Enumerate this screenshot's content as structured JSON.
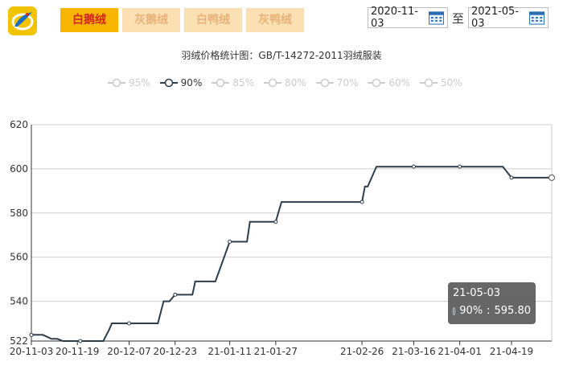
{
  "tabs": [
    {
      "label": "白鹅绒",
      "active": true
    },
    {
      "label": "灰鹅绒",
      "active": false
    },
    {
      "label": "白鸭绒",
      "active": false
    },
    {
      "label": "灰鸭绒",
      "active": false
    }
  ],
  "date_range": {
    "start": "2020-11-03",
    "separator": "至",
    "end": "2021-05-03"
  },
  "tooltip": {
    "date": "21-05-03",
    "series": "90%",
    "sep": " : ",
    "value": "595.80"
  },
  "colors": {
    "line": "#2f3e4d",
    "tab_active_bg": "#f7b500",
    "tab_active_text": "#d0281b",
    "tab_bg": "#fbe0b3",
    "tab_text": "#e8b27a",
    "logo": "#f2c300"
  },
  "chart_data": {
    "type": "line",
    "title": "羽绒价格统计图：GB/T-14272-2011羽绒服装",
    "legend": [
      "95%",
      "90%",
      "85%",
      "80%",
      "70%",
      "60%",
      "50%"
    ],
    "active_series": "90%",
    "x_ticks": [
      "20-11-03",
      "20-11-19",
      "20-12-07",
      "20-12-23",
      "21-01-11",
      "21-01-27",
      "21-02-26",
      "21-03-16",
      "21-04-01",
      "21-04-19"
    ],
    "ylim": [
      522,
      620
    ],
    "y_ticks": [
      522,
      540,
      560,
      580,
      600,
      620
    ],
    "grid": true,
    "series": [
      {
        "name": "90%",
        "points": [
          [
            "2020-11-03",
            524.8
          ],
          [
            "2020-11-07",
            524.8
          ],
          [
            "2020-11-10",
            523
          ],
          [
            "2020-11-12",
            523
          ],
          [
            "2020-11-14",
            522
          ],
          [
            "2020-11-20",
            522
          ],
          [
            "2020-11-28",
            522
          ],
          [
            "2020-11-30",
            527
          ],
          [
            "2020-12-01",
            530
          ],
          [
            "2020-12-07",
            530
          ],
          [
            "2020-12-17",
            530
          ],
          [
            "2020-12-19",
            540
          ],
          [
            "2020-12-21",
            540
          ],
          [
            "2020-12-23",
            543
          ],
          [
            "2020-12-29",
            543
          ],
          [
            "2020-12-30",
            549
          ],
          [
            "2021-01-06",
            549
          ],
          [
            "2021-01-11",
            567
          ],
          [
            "2021-01-17",
            567
          ],
          [
            "2021-01-18",
            576
          ],
          [
            "2021-01-27",
            576
          ],
          [
            "2021-01-29",
            585
          ],
          [
            "2021-02-26",
            585
          ],
          [
            "2021-02-27",
            592
          ],
          [
            "2021-02-28",
            592
          ],
          [
            "2021-03-03",
            601
          ],
          [
            "2021-03-16",
            601
          ],
          [
            "2021-04-01",
            601
          ],
          [
            "2021-04-16",
            601
          ],
          [
            "2021-04-19",
            596
          ],
          [
            "2021-05-03",
            596
          ]
        ],
        "markers": [
          [
            "2020-11-03",
            524.8
          ],
          [
            "2020-11-20",
            522
          ],
          [
            "2020-12-07",
            530
          ],
          [
            "2020-12-23",
            543
          ],
          [
            "2021-01-11",
            567
          ],
          [
            "2021-01-27",
            576
          ],
          [
            "2021-02-26",
            585
          ],
          [
            "2021-03-16",
            601
          ],
          [
            "2021-04-01",
            601
          ],
          [
            "2021-04-19",
            596
          ],
          [
            "2021-05-03",
            596
          ]
        ]
      }
    ]
  }
}
